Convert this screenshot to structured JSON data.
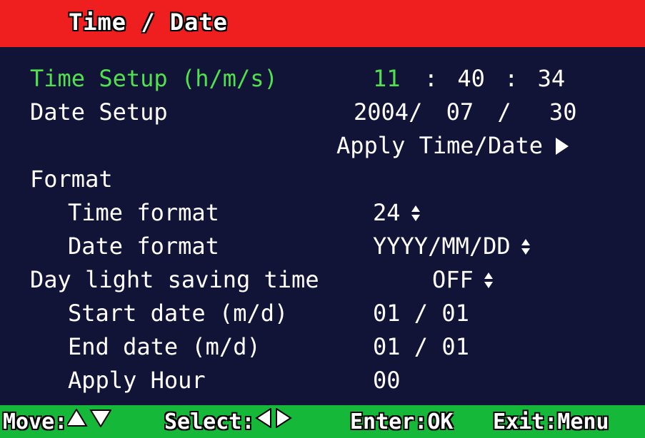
{
  "header": {
    "title": "Time / Date"
  },
  "time_setup": {
    "label": "Time Setup (h/m/s)",
    "hour": "11",
    "sep1": ":",
    "minute": "40",
    "sep2": ":",
    "second": "34"
  },
  "date_setup": {
    "label": "Date Setup",
    "year": "2004",
    "sep1": "/",
    "month": "07",
    "sep2": "/",
    "day": "30"
  },
  "apply_time_date": {
    "label": "Apply Time/Date"
  },
  "format": {
    "section_label": "Format",
    "time_format_label": "Time format",
    "time_format_value": "24",
    "date_format_label": "Date format",
    "date_format_value": "YYYY/MM/DD"
  },
  "dst": {
    "label": "Day light saving time",
    "value": "OFF",
    "start_label": "Start date (m/d)",
    "start_value": "01 / 01",
    "end_label": "End date (m/d)",
    "end_value": "01 / 01",
    "apply_hour_label": "Apply Hour",
    "apply_hour_value": "00"
  },
  "footer": {
    "move_label": "Move:",
    "select_label": "Select:",
    "enter_label": "Enter:OK",
    "exit_label": "Exit:Menu"
  },
  "colors": {
    "title_bar": "#ef1f20",
    "background": "#111436",
    "footer_bar": "#16b83a",
    "highlight": "#4fe14e"
  }
}
